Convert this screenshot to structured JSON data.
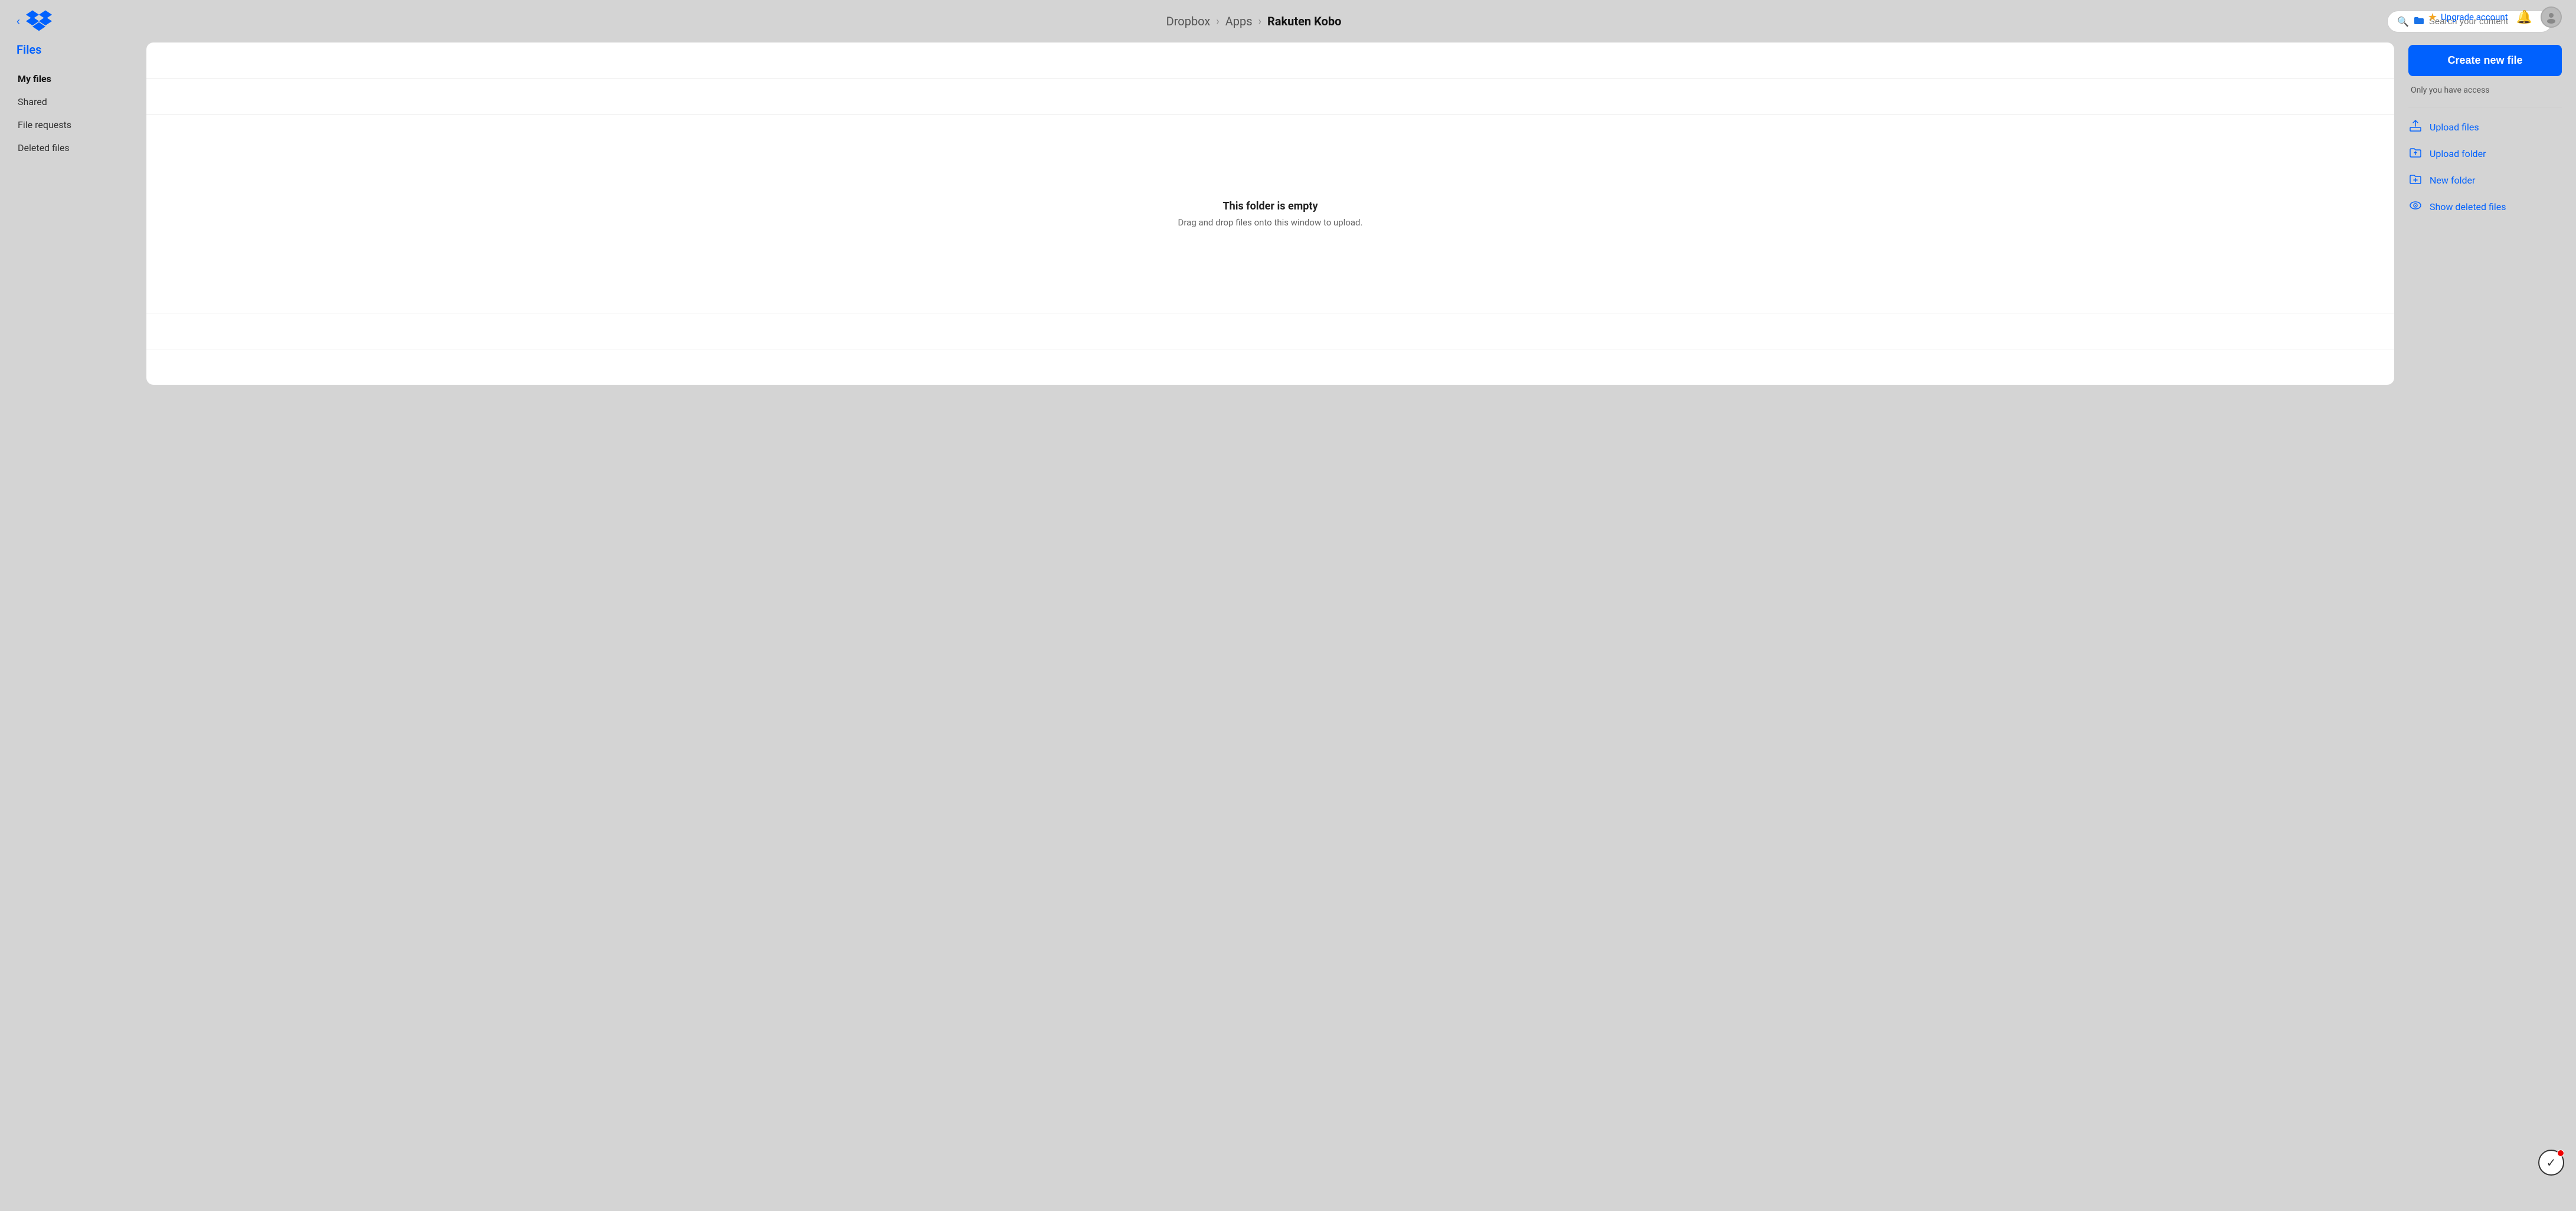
{
  "topbar": {
    "upgrade_label": "Upgrade account",
    "breadcrumb": {
      "root": "Dropbox",
      "sep1": "›",
      "mid": "Apps",
      "sep2": "›",
      "current": "Rakuten Kobo"
    },
    "search": {
      "placeholder": "Search your content"
    }
  },
  "sidebar": {
    "section_title": "Files",
    "nav_items": [
      {
        "id": "my-files",
        "label": "My files",
        "active": true
      },
      {
        "id": "shared",
        "label": "Shared",
        "active": false
      },
      {
        "id": "file-requests",
        "label": "File requests",
        "active": false
      },
      {
        "id": "deleted-files",
        "label": "Deleted files",
        "active": false
      }
    ]
  },
  "empty_state": {
    "title": "This folder is empty",
    "subtitle": "Drag and drop files onto this window to upload."
  },
  "right_panel": {
    "create_button": "Create new file",
    "access_text": "Only you have access",
    "actions": [
      {
        "id": "upload-files",
        "label": "Upload files",
        "icon": "upload-file"
      },
      {
        "id": "upload-folder",
        "label": "Upload folder",
        "icon": "upload-folder"
      },
      {
        "id": "new-folder",
        "label": "New folder",
        "icon": "new-folder"
      },
      {
        "id": "show-deleted",
        "label": "Show deleted files",
        "icon": "show-deleted"
      }
    ]
  }
}
